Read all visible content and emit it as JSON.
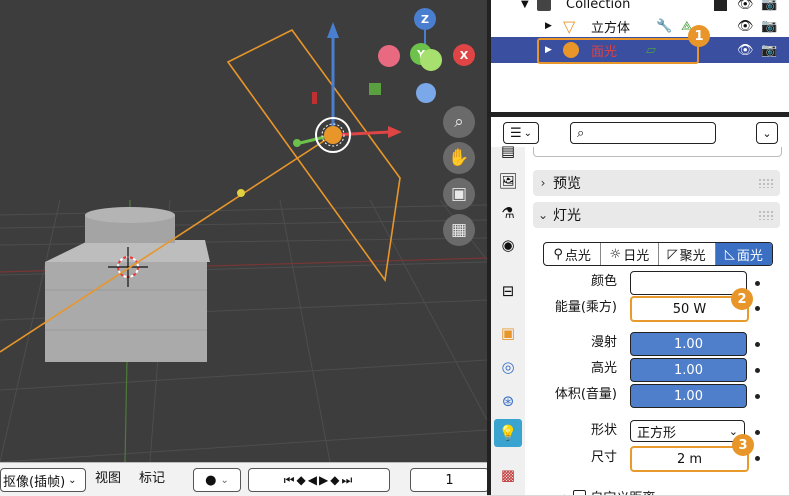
{
  "viewport": {
    "gizmo": {
      "z": "Z",
      "x": "X",
      "y": "Y"
    },
    "nav_icons": [
      "zoom-icon",
      "hand-icon",
      "camera-icon",
      "grid-icon"
    ]
  },
  "timeline": {
    "keying_label": "抠像(插帧)",
    "view_label": "视图",
    "marker_label": "标记",
    "frame": "1"
  },
  "outliner": {
    "collection": "Collection",
    "items": [
      {
        "name": "立方体",
        "color": "#111111"
      },
      {
        "name": "面光",
        "color": "#e04040"
      }
    ]
  },
  "properties": {
    "sections": {
      "preview": "预览",
      "light": "灯光",
      "custom_distance": "自定义距离"
    },
    "light_types": [
      "点光",
      "日光",
      "聚光",
      "面光"
    ],
    "active_light_type": "面光",
    "fields": {
      "color_label": "颜色",
      "energy_label": "能量(乘方)",
      "energy_value": "50 W",
      "diffuse_label": "漫射",
      "diffuse_value": "1.00",
      "specular_label": "高光",
      "specular_value": "1.00",
      "volume_label": "体积(音量)",
      "volume_value": "1.00",
      "shape_label": "形状",
      "shape_value": "正方形",
      "size_label": "尺寸",
      "size_value": "2 m"
    }
  },
  "badges": [
    "1",
    "2",
    "3"
  ],
  "colors": {
    "accent_orange": "#e8962a",
    "selection_blue": "#3a4fa0",
    "field_blue": "#4f7fcb"
  }
}
